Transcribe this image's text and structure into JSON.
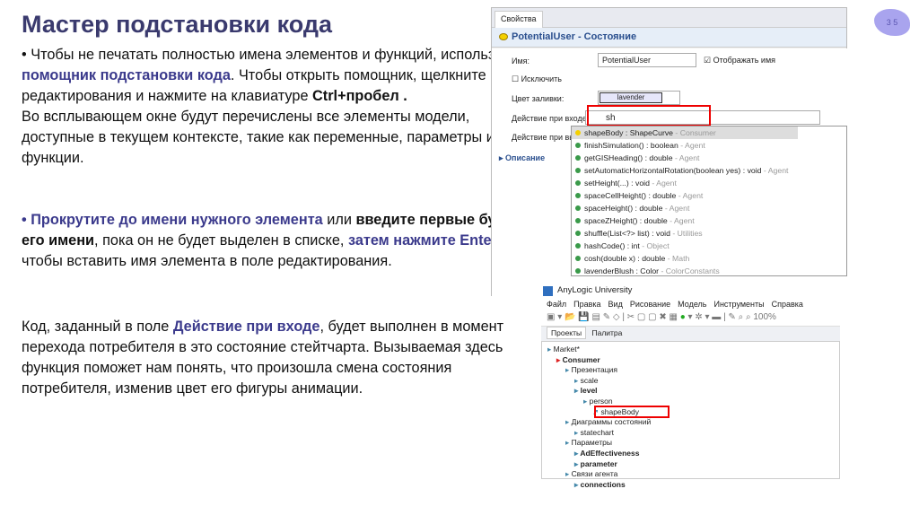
{
  "slide": {
    "title": "Мастер подстановки кода",
    "page_number": "3 5",
    "p1": {
      "a": "• Чтобы не печатать полностью имена элементов и функций, используйте ",
      "b": "помощник подстановки кода",
      "c": ". Чтобы открыть помощник, щелкните в поле редактирования и нажмите на клавиатуре ",
      "d": "Ctrl+пробел .",
      "e": "Во всплывающем окне будут перечислены все элементы модели, доступные в текущем контексте, такие как переменные, параметры и функции."
    },
    "p2": {
      "a": "• Прокрутите до имени нужного элемента",
      "b": " или ",
      "c": "введите первые буквы его имени",
      "d": ", пока он не будет выделен в списке, ",
      "e": "затем нажмите Enter",
      "f": ", чтобы вставить имя элемента в поле редактирования."
    },
    "p3": {
      "a": "Код, заданный в поле ",
      "b": "Действие при входе",
      "c": ", будет выполнен в момент перехода потребителя в это состояние стейтчарта. Вызываемая здесь функция поможет нам понять, что произошла смена состояния потребителя, изменив цвет его фигуры анимации."
    }
  },
  "props": {
    "tab": "Свойства",
    "header": "PotentialUser - Состояние",
    "name_label": "Имя:",
    "name_value": "PotentialUser",
    "show_name": "Отображать имя",
    "exclude": "Исключить",
    "fill_label": "Цвет заливки:",
    "fill_value": "lavender",
    "entry_label": "Действие при входе:",
    "entry_value": "sh",
    "exit_label": "Действие при вы",
    "description": "▸ Описание",
    "suggestions": [
      {
        "name": "shapeBody : ShapeCurve",
        "src": " - Consumer"
      },
      {
        "name": "finishSimulation() : boolean",
        "src": " - Agent"
      },
      {
        "name": "getGISHeading() : double",
        "src": " - Agent"
      },
      {
        "name": "setAutomaticHorizontalRotation(boolean yes) : void",
        "src": " - Agent"
      },
      {
        "name": "setHeight(...) : void",
        "src": " - Agent"
      },
      {
        "name": "spaceCellHeight() : double",
        "src": " - Agent"
      },
      {
        "name": "spaceHeight() : double",
        "src": " - Agent"
      },
      {
        "name": "spaceZHeight() : double",
        "src": " - Agent"
      },
      {
        "name": "shuffle(List<?> list) : void",
        "src": " - Utilities"
      },
      {
        "name": "hashCode() : int",
        "src": " - Object"
      },
      {
        "name": "cosh(double x) : double",
        "src": " - Math"
      },
      {
        "name": "lavenderBlush : Color",
        "src": " - ColorConstants"
      }
    ]
  },
  "ide": {
    "title": "AnyLogic University",
    "menu": [
      "Файл",
      "Правка",
      "Вид",
      "Рисование",
      "Модель",
      "Инструменты",
      "Справка"
    ],
    "zoom": "100%",
    "tabs": [
      "Проекты",
      "Палитра"
    ],
    "tree": [
      "Market*",
      "Consumer",
      "Презентация",
      "scale",
      "level",
      "person",
      "shapeBody",
      "Диаграммы состояний",
      "statechart",
      "Параметры",
      "AdEffectiveness",
      "parameter",
      "Связи агента",
      "connections"
    ]
  }
}
